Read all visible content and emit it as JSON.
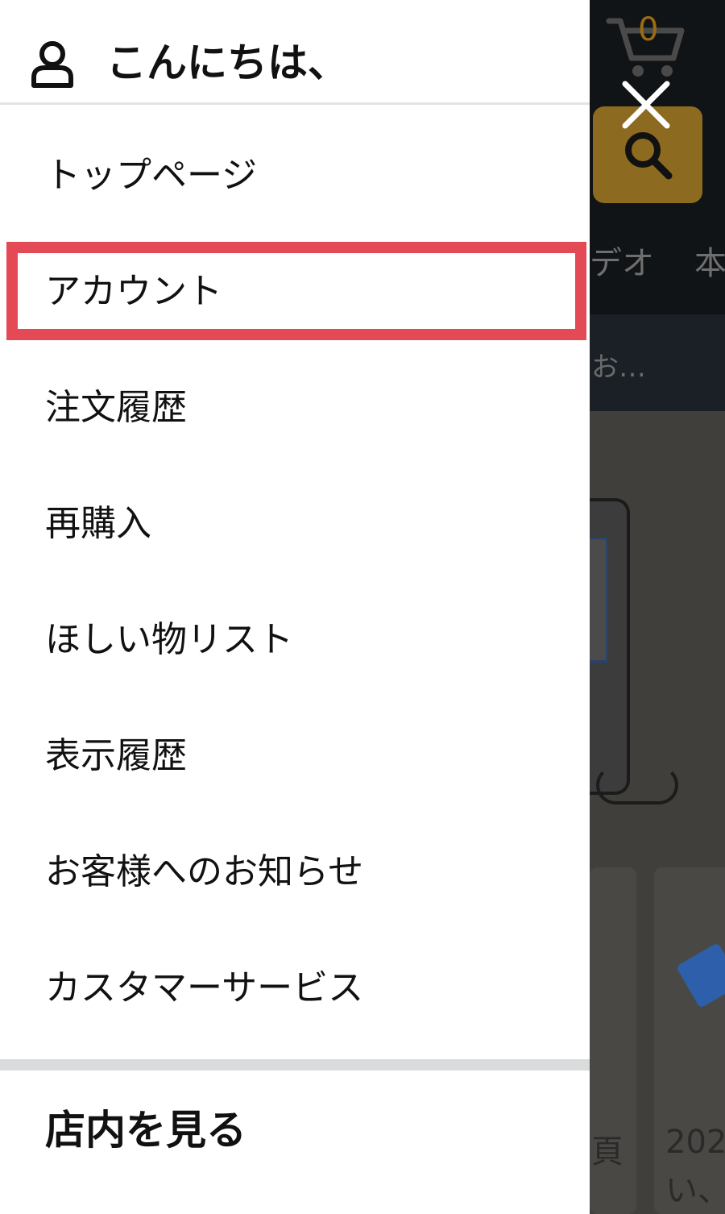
{
  "background": {
    "cart_count": "0",
    "nav_partial_1": "デオ",
    "nav_partial_2": "本",
    "sub_partial": "お…",
    "card_partial_1": "頁",
    "card_partial_2": "202",
    "card_partial_3": "い、"
  },
  "drawer": {
    "greeting": "こんにちは、",
    "menu": [
      {
        "label": "トップページ"
      },
      {
        "label": "アカウント",
        "highlighted": true
      },
      {
        "label": "注文履歴"
      },
      {
        "label": "再購入"
      },
      {
        "label": "ほしい物リスト"
      },
      {
        "label": "表示履歴"
      },
      {
        "label": "お客様へのお知らせ"
      },
      {
        "label": "カスタマーサービス"
      }
    ],
    "section_title": "店内を見る"
  },
  "colors": {
    "highlight": "#e44a55",
    "divider": "#d9dbdd",
    "text": "#111111"
  },
  "icons": {
    "user": "user-icon",
    "close": "close-icon",
    "cart": "cart-icon",
    "search": "search-icon"
  }
}
